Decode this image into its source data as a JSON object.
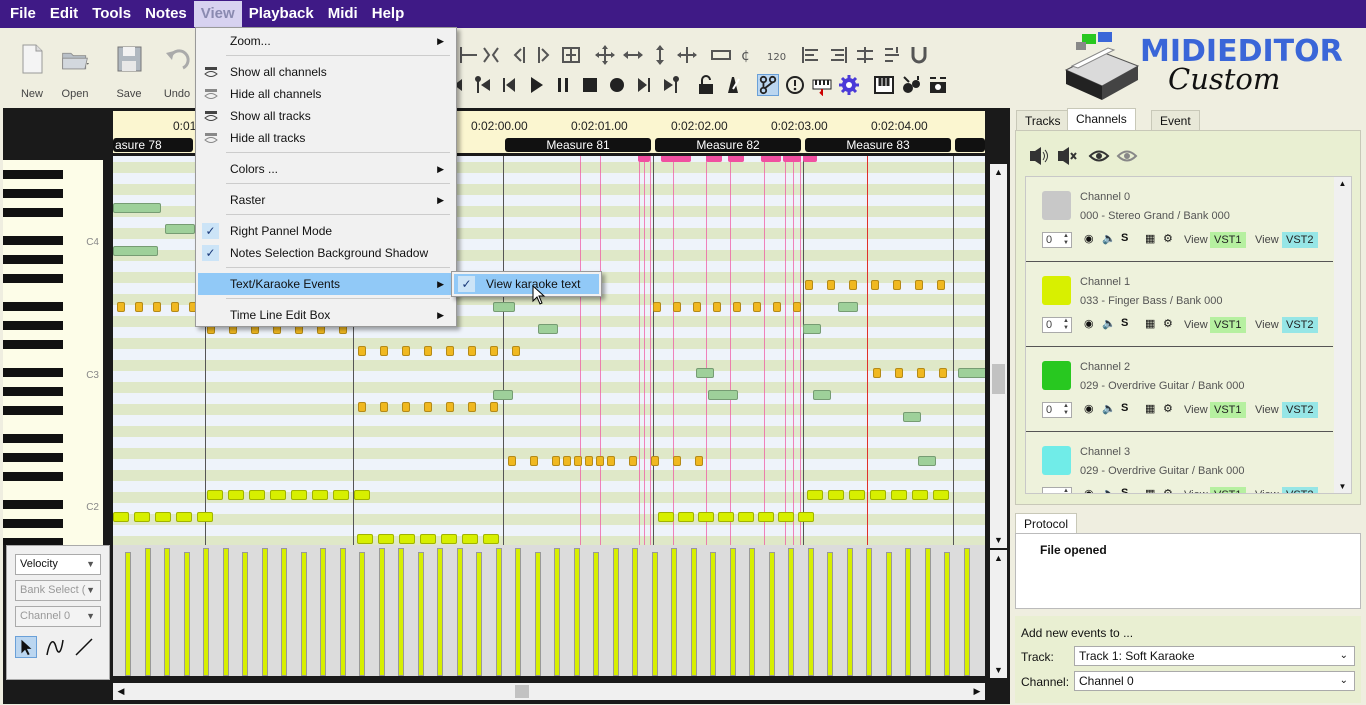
{
  "menubar": {
    "items": [
      "File",
      "Edit",
      "Tools",
      "Notes",
      "View",
      "Playback",
      "Midi",
      "Help"
    ],
    "active": "View"
  },
  "toolbar": {
    "new_label": "New",
    "open_label": "Open",
    "save_label": "Save",
    "undo_label": "Undo"
  },
  "logo": {
    "title": "MIDIEDITOR",
    "subtitle": "Custom"
  },
  "view_menu": {
    "zoom": "Zoom...",
    "show_all_channels": "Show all channels",
    "hide_all_channels": "Hide all channels",
    "show_all_tracks": "Show all tracks",
    "hide_all_tracks": "Hide all tracks",
    "colors": "Colors ...",
    "raster": "Raster",
    "right_pannel_mode": "Right Pannel Mode",
    "notes_selection_shadow": "Notes Selection Background Shadow",
    "text_karaoke_events": "Text/Karaoke Events",
    "time_line_edit_box": "Time Line Edit Box"
  },
  "karaoke_submenu": {
    "view_karaoke_text": "View karaoke text"
  },
  "timeline": {
    "times": [
      "0:01",
      "0:02:00.00",
      "0:02:01.00",
      "0:02:02.00",
      "0:02:03.00",
      "0:02:04.00"
    ],
    "measures": [
      "asure 78",
      "Measure 81",
      "Measure 82",
      "Measure 83"
    ]
  },
  "piano": {
    "labels": [
      "C4",
      "C3",
      "C2"
    ]
  },
  "left_panel": {
    "velocity": "Velocity",
    "bank_select": "Bank Select (",
    "channel": "Channel 0"
  },
  "right_panel": {
    "tabs": [
      "Tracks",
      "Channels",
      "Event"
    ],
    "channels": [
      {
        "name": "Channel 0",
        "program": "000 - Stereo Grand / Bank 000",
        "color": "#c8c8c8",
        "spin": "0"
      },
      {
        "name": "Channel 1",
        "program": "033 - Finger Bass / Bank 000",
        "color": "#d8f000",
        "spin": "0"
      },
      {
        "name": "Channel 2",
        "program": "029 - Overdrive Guitar / Bank 000",
        "color": "#28c820",
        "spin": "0"
      },
      {
        "name": "Channel 3",
        "program": "029 - Overdrive Guitar / Bank 000",
        "color": "#70ece8",
        "spin": ""
      }
    ],
    "solo_label": "S",
    "view_label": "View",
    "vst1_label": "VST1",
    "vst2_label": "VST2",
    "protocol_tab": "Protocol",
    "protocol_entry": "File opened",
    "add_events_label": "Add new events to ...",
    "track_label": "Track:",
    "track_value": "Track 1: Soft Karaoke",
    "channel_label": "Channel:",
    "channel_value": "Channel 0"
  },
  "colors": {
    "menubar": "#3f1a86",
    "highlight": "#91c9f7",
    "note_orange": "#f0b820",
    "note_lime": "#d7ef00",
    "note_green": "#9ed09a",
    "karaoke_pink": "#f050a0"
  }
}
